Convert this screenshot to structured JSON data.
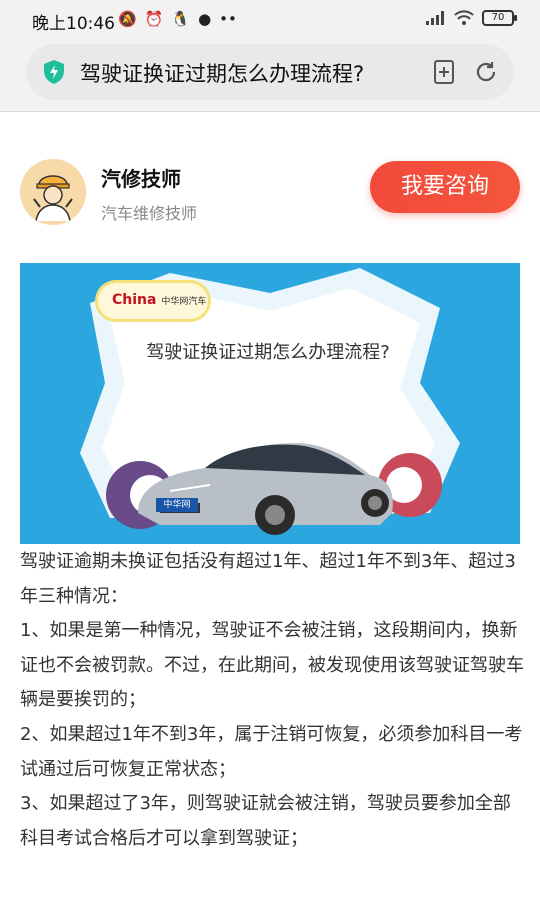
{
  "status_bar": {
    "time": "晚上10:46",
    "icons": [
      "mute-icon",
      "alarm-icon",
      "qq-icon",
      "app-icon",
      "more-icon"
    ],
    "battery": "70"
  },
  "search": {
    "query": "驾驶证换证过期怎么办理流程?"
  },
  "author": {
    "name": "汽修技师",
    "title": "汽车维修技师",
    "consult_label": "我要咨询"
  },
  "banner": {
    "logo_text": "China",
    "logo_sub": "中华网汽车",
    "title": "驾驶证换证过期怎么办理流程?",
    "plate_text": "中华网"
  },
  "article": {
    "paragraphs": [
      "驾驶证逾期未换证包括没有超过1年、超过1年不到3年、超过3年三种情况：",
      "1、如果是第一种情况，驾驶证不会被注销，这段期间内，换新证也不会被罚款。不过，在此期间，被发现使用该驾驶证驾驶车辆是要挨罚的；",
      "2、如果超过1年不到3年，属于注销可恢复，必须参加科目一考试通过后可恢复正常状态；",
      "3、如果超过了3年，则驾驶证就会被注销，驾驶员要参加全部科目考试合格后才可以拿到驾驶证；"
    ]
  },
  "colors": {
    "accent": "#f24a3a",
    "banner_bg": "#2ba6de",
    "shield": "#1fbf9c"
  }
}
